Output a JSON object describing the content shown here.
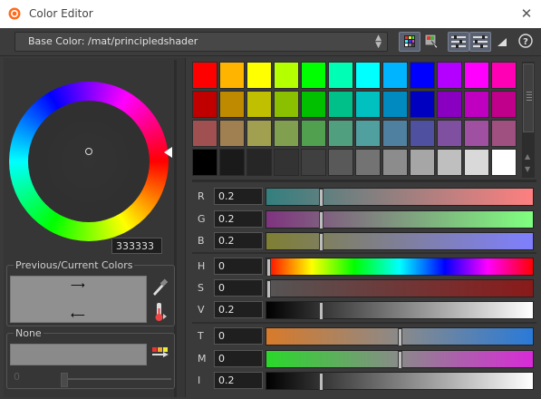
{
  "window": {
    "title": "Color Editor",
    "close_icon": "close-icon",
    "app_icon": "houdini-icon"
  },
  "toolbar": {
    "path_label": "Base Color: /mat/principledshader",
    "buttons": [
      "palette-grid-icon",
      "eyedropper-screen-icon",
      "sliders-icon",
      "sliders-alt-icon",
      "triangle-menu-icon",
      "help-icon"
    ],
    "help_label": "?"
  },
  "wheel": {
    "hex": "333333"
  },
  "previous_current": {
    "label": "Previous/Current Colors",
    "color": "#909090"
  },
  "none_group": {
    "label": "None",
    "slider_value": "0"
  },
  "palette": {
    "rows": [
      [
        "#ff0000",
        "#ffb400",
        "#ffff00",
        "#b4ff00",
        "#00ff00",
        "#00ffb4",
        "#00ffff",
        "#00b4ff",
        "#0000ff",
        "#b400ff",
        "#ff00ff",
        "#ff00b4"
      ],
      [
        "#c00000",
        "#c08a00",
        "#c0c000",
        "#8ac000",
        "#00c000",
        "#00c08a",
        "#00c0c0",
        "#008ac0",
        "#0000c0",
        "#8a00c0",
        "#c000c0",
        "#c0008a"
      ],
      [
        "#a05050",
        "#a08050",
        "#a0a050",
        "#80a050",
        "#50a050",
        "#50a080",
        "#50a0a0",
        "#5080a0",
        "#5050a0",
        "#8050a0",
        "#a050a0",
        "#a05080"
      ],
      [
        "#000000",
        "#1a1a1a",
        "#262626",
        "#333333",
        "#404040",
        "#595959",
        "#737373",
        "#8c8c8c",
        "#a6a6a6",
        "#bfbfbf",
        "#d9d9d9",
        "#ffffff"
      ]
    ]
  },
  "sliders": [
    {
      "letter": "R",
      "value": "0.2",
      "level": 0.2,
      "gradient": "linear-gradient(to right, #337f7f, #ff7f7f)"
    },
    {
      "letter": "G",
      "value": "0.2",
      "level": 0.2,
      "gradient": "linear-gradient(to right, #7f337f, #7fff7f)"
    },
    {
      "letter": "B",
      "value": "0.2",
      "level": 0.2,
      "gradient": "linear-gradient(to right, #7f7f33, #7f7fff)"
    },
    {
      "letter": "H",
      "value": "0",
      "level": 0.0,
      "gradient": "linear-gradient(to right, #ff0000, #ffff00 17%, #00ff00 33%, #00ffff 50%, #0000ff 67%, #ff00ff 83%, #ff0000)"
    },
    {
      "letter": "S",
      "value": "0",
      "level": 0.0,
      "gradient": "linear-gradient(to right, #555555, #8a1a1a)"
    },
    {
      "letter": "V",
      "value": "0.2",
      "level": 0.2,
      "gradient": "linear-gradient(to right, #000000, #ffffff)"
    },
    {
      "letter": "T",
      "value": "0",
      "level": 0.5,
      "gradient": "linear-gradient(to right, #d87a2a, #8a8a8a 50%, #2a7ad8)"
    },
    {
      "letter": "M",
      "value": "0",
      "level": 0.5,
      "gradient": "linear-gradient(to right, #2ad82a, #8a8a8a 50%, #d82ad8)"
    },
    {
      "letter": "I",
      "value": "0.2",
      "level": 0.2,
      "gradient": "linear-gradient(to right, #000000, #ffffff)"
    }
  ]
}
